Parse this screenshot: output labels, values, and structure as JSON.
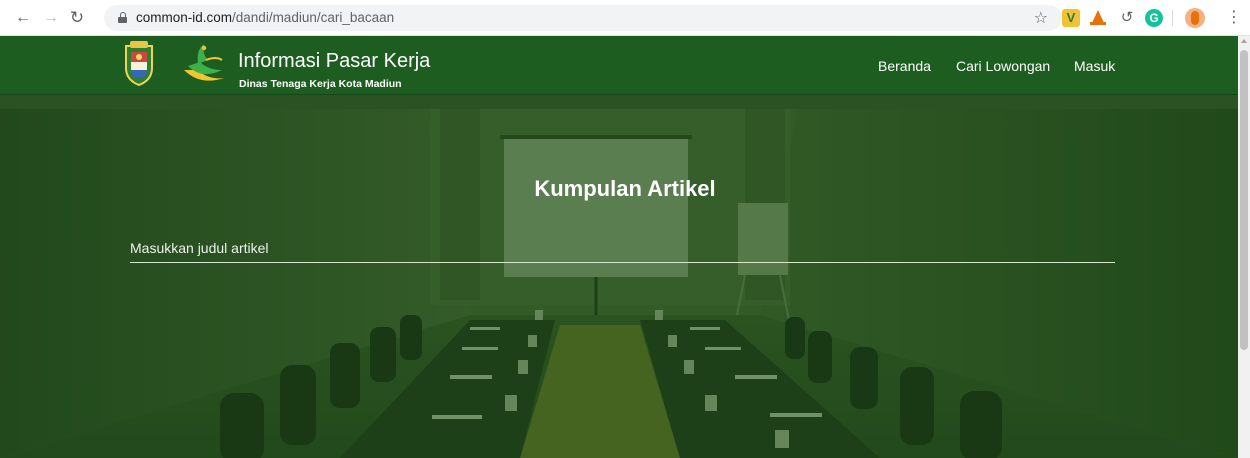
{
  "browser": {
    "url_host": "common-id.com",
    "url_path": "/dandi/madiun/cari_bacaan",
    "extension_v_label": "V",
    "extension_g_label": "G",
    "icons": {
      "back": "arrow-left-icon",
      "forward": "arrow-right-icon",
      "reload": "reload-icon",
      "secure": "lock-icon",
      "bookmark": "star-icon",
      "menu": "kebab-menu-icon"
    }
  },
  "site": {
    "brand_title": "Informasi Pasar Kerja",
    "brand_subtitle": "Dinas Tenaga Kerja Kota Madiun",
    "nav": [
      {
        "label": "Beranda"
      },
      {
        "label": "Cari Lowongan"
      },
      {
        "label": "Masuk"
      }
    ],
    "colors": {
      "navbar": "#1d5e20",
      "hero_overlay": "#164a10"
    }
  },
  "hero": {
    "title": "Kumpulan Artikel",
    "search_placeholder": "Masukkan judul artikel"
  }
}
